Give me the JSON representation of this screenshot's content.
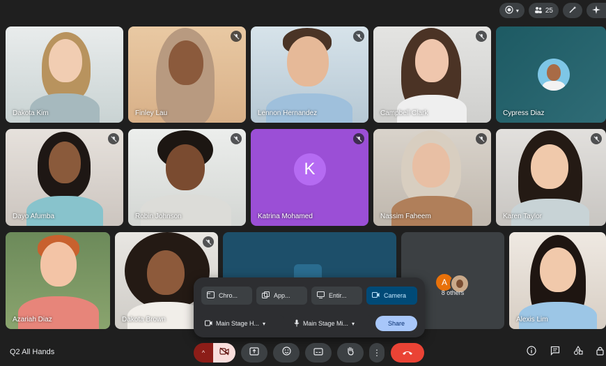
{
  "meeting": {
    "title": "Q2 All Hands"
  },
  "topbar": {
    "participant_count": "25"
  },
  "tiles": [
    {
      "name": "Dakota Kim"
    },
    {
      "name": "Finley Lau"
    },
    {
      "name": "Lennon Hernandez"
    },
    {
      "name": "Campbell Clark"
    },
    {
      "name": "Cypress Diaz"
    },
    {
      "name": "Dayo Afumba"
    },
    {
      "name": "Robin Johnson"
    },
    {
      "name": "Katrina Mohamed",
      "initial": "K"
    },
    {
      "name": "Nassim Faheem"
    },
    {
      "name": "Karen Taylor"
    },
    {
      "name": "Azariah Diaz"
    },
    {
      "name": "Dakota Brown"
    },
    {
      "name": "Alexis Lim"
    }
  ],
  "others": {
    "label": "8 others",
    "initial": "A"
  },
  "share_popup": {
    "options": [
      "Chro...",
      "App...",
      "Entir...",
      "Camera"
    ],
    "video_source": "Main Stage H...",
    "audio_source": "Main Stage Mi...",
    "share_label": "Share"
  },
  "colors": {
    "accent": "#a8c7fa",
    "end_call": "#ea4335",
    "active_camera": "#004a77",
    "katrina_tile": "#9b4fd6"
  }
}
